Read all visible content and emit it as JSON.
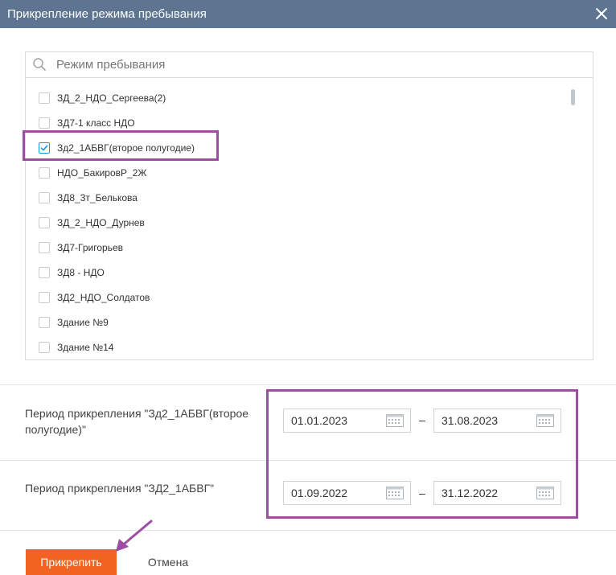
{
  "dialog": {
    "title": "Прикрепление режима пребывания"
  },
  "search": {
    "placeholder": "Режим пребывания",
    "value": ""
  },
  "list": {
    "items": [
      {
        "label": "ЗД_2_НДО_Сергеева(2)",
        "checked": false
      },
      {
        "label": "ЗД7-1 класс НДО",
        "checked": false
      },
      {
        "label": "Зд2_1АБВГ(второе полугодие)",
        "checked": true
      },
      {
        "label": "НДО_БакировР_2Ж",
        "checked": false
      },
      {
        "label": "ЗД8_3т_Белькова",
        "checked": false
      },
      {
        "label": "ЗД_2_НДО_Дурнев",
        "checked": false
      },
      {
        "label": "ЗД7-Григорьев",
        "checked": false
      },
      {
        "label": "ЗД8 - НДО",
        "checked": false
      },
      {
        "label": "ЗД2_НДО_Солдатов",
        "checked": false
      },
      {
        "label": "Здание №9",
        "checked": false
      },
      {
        "label": "Здание №14",
        "checked": false
      }
    ]
  },
  "periods": [
    {
      "label": "Период прикрепления \"Зд2_1АБВГ(второе полугодие)\"",
      "start": "01.01.2023",
      "separator": "–",
      "end": "31.08.2023"
    },
    {
      "label": "Период прикрепления \"ЗД2_1АБВГ\"",
      "start": "01.09.2022",
      "separator": "–",
      "end": "31.12.2022"
    }
  ],
  "footer": {
    "attach_label": "Прикрепить",
    "cancel_label": "Отмена"
  },
  "colors": {
    "titlebar": "#5d7590",
    "primary": "#f26322",
    "checkbox_checked": "#1a9bd7",
    "annotation": "#9c4ea3"
  },
  "icons": {
    "close": "close-icon",
    "search": "search-icon",
    "calendar": "calendar-icon",
    "check": "checkmark-icon"
  }
}
